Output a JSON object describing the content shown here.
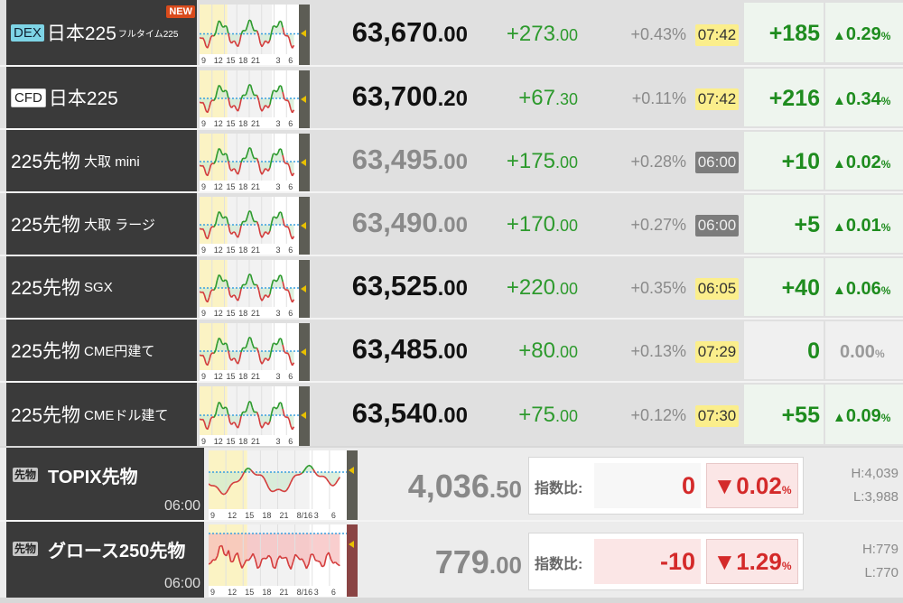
{
  "rows": [
    {
      "tag": "DEX",
      "name": "日本225",
      "sub": "フルタイム225",
      "new": "NEW",
      "price_int": "63,670",
      "price_dec": ".00",
      "price_grey": false,
      "chg_int": "+273",
      "chg_dec": ".00",
      "pct": "+0.43%",
      "time": "07:42",
      "time_style": "yel",
      "diff": "+185",
      "pmark": "▲",
      "pval": "0.29",
      "pu": "%",
      "neutral": false
    },
    {
      "tag": "CFD",
      "name": "日本225",
      "sub": "",
      "new": "",
      "price_int": "63,700",
      "price_dec": ".20",
      "price_grey": false,
      "chg_int": "+67",
      "chg_dec": ".30",
      "pct": "+0.11%",
      "time": "07:42",
      "time_style": "yel",
      "diff": "+216",
      "pmark": "▲",
      "pval": "0.34",
      "pu": "%",
      "neutral": false
    },
    {
      "tag": "",
      "name": "225先物",
      "sub": "大取 mini",
      "new": "",
      "price_int": "63,495",
      "price_dec": ".00",
      "price_grey": true,
      "chg_int": "+175",
      "chg_dec": ".00",
      "pct": "+0.28%",
      "time": "06:00",
      "time_style": "gry",
      "diff": "+10",
      "pmark": "▲",
      "pval": "0.02",
      "pu": "%",
      "neutral": false
    },
    {
      "tag": "",
      "name": "225先物",
      "sub": "大取 ラージ",
      "new": "",
      "price_int": "63,490",
      "price_dec": ".00",
      "price_grey": true,
      "chg_int": "+170",
      "chg_dec": ".00",
      "pct": "+0.27%",
      "time": "06:00",
      "time_style": "gry",
      "diff": "+5",
      "pmark": "▲",
      "pval": "0.01",
      "pu": "%",
      "neutral": false
    },
    {
      "tag": "",
      "name": "225先物",
      "sub": "SGX",
      "new": "",
      "price_int": "63,525",
      "price_dec": ".00",
      "price_grey": false,
      "chg_int": "+220",
      "chg_dec": ".00",
      "pct": "+0.35%",
      "time": "06:05",
      "time_style": "yel",
      "diff": "+40",
      "pmark": "▲",
      "pval": "0.06",
      "pu": "%",
      "neutral": false
    },
    {
      "tag": "",
      "name": "225先物",
      "sub": "CME円建て",
      "new": "",
      "price_int": "63,485",
      "price_dec": ".00",
      "price_grey": false,
      "chg_int": "+80",
      "chg_dec": ".00",
      "pct": "+0.13%",
      "time": "07:29",
      "time_style": "yel",
      "diff": "0",
      "pmark": "",
      "pval": "0.00",
      "pu": "%",
      "neutral": true
    },
    {
      "tag": "",
      "name": "225先物",
      "sub": "CMEドル建て",
      "new": "",
      "price_int": "63,540",
      "price_dec": ".00",
      "price_grey": false,
      "chg_int": "+75",
      "chg_dec": ".00",
      "pct": "+0.12%",
      "time": "07:30",
      "time_style": "yel",
      "diff": "+55",
      "pmark": "▲",
      "pval": "0.09",
      "pu": "%",
      "neutral": false
    }
  ],
  "chart_ticks": [
    "9",
    "12",
    "15",
    "18",
    "21",
    "",
    "3",
    "6"
  ],
  "lower": [
    {
      "badge": "先物",
      "name": "TOPIX先物",
      "time": "06:00",
      "price_int": "4,036",
      "price_dec": ".50",
      "label": "指数比:",
      "v1": "0",
      "v2mark": "▼",
      "v2": "0.02",
      "v2u": "%",
      "high": "H:4,039",
      "low": "L:3,988",
      "ticks": [
        "9",
        "12",
        "15",
        "18",
        "21",
        "8/16",
        "3",
        "6"
      ]
    },
    {
      "badge": "先物",
      "name": "グロース250先物",
      "time": "06:00",
      "price_int": "779",
      "price_dec": ".00",
      "label": "指数比:",
      "v1": "-10",
      "v2mark": "▼",
      "v2": "1.29",
      "v2u": "%",
      "high": "H:779",
      "low": "L:770",
      "ticks": [
        "9",
        "12",
        "15",
        "18",
        "21",
        "8/16",
        "3",
        "6"
      ]
    }
  ],
  "colors": {
    "up": "#2d9a2d",
    "down": "#d42a2a",
    "time_highlight": "#fbee8c"
  }
}
